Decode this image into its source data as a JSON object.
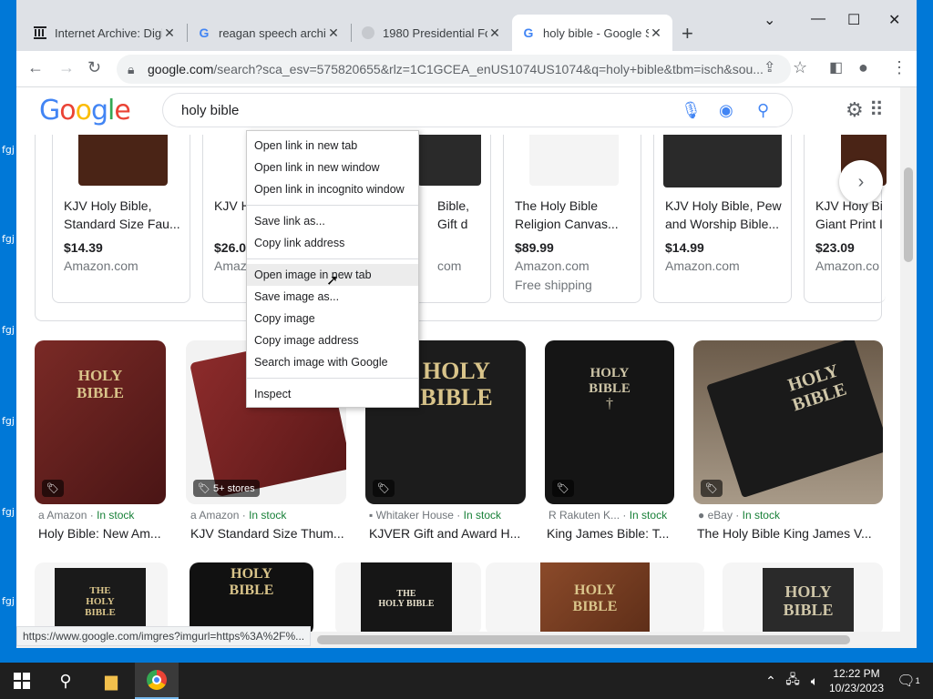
{
  "desktop": {
    "labels": [
      "fgj",
      "fgj",
      "fgj",
      "fgj",
      "fgj",
      "fgj"
    ]
  },
  "tabs": [
    {
      "title": "Internet Archive: Digi",
      "favicon": "archive-icon"
    },
    {
      "title": "reagan speech archiv",
      "favicon": "google-icon"
    },
    {
      "title": "1980 Presidential For",
      "favicon": "loading-icon"
    },
    {
      "title": "holy bible - Google S",
      "favicon": "google-icon",
      "active": true
    }
  ],
  "address": {
    "host": "google.com",
    "path": "/search?sca_esv=575820655&rlz=1C1GCEA_enUS1074US1074&q=holy+bible&tbm=isch&sou..."
  },
  "search": {
    "query": "holy bible"
  },
  "shopping": [
    {
      "title": "KJV Holy Bible, Standard Size Fau...",
      "price": "$14.39",
      "store": "Amazon.com",
      "shipping": ""
    },
    {
      "title": "KJV H Giant",
      "price": "$26.0",
      "store": "Amaz",
      "shipping": ""
    },
    {
      "title": "Bible, Gift d Bible -...",
      "price": "",
      "store": "com",
      "shipping": ""
    },
    {
      "title": "The Holy Bible Religion Canvas...",
      "price": "$89.99",
      "store": "Amazon.com",
      "shipping": "Free shipping"
    },
    {
      "title": "KJV Holy Bible, Pew and Worship Bible...",
      "price": "$14.99",
      "store": "Amazon.com",
      "shipping": ""
    },
    {
      "title": "KJV Holy Bi Giant Print I",
      "price": "$23.09",
      "store": "Amazon.co",
      "shipping": ""
    }
  ],
  "results": [
    {
      "store": "Amazon",
      "stock": "In stock",
      "title": "Holy Bible: New Am...",
      "cover": "HOLY\nBIBLE",
      "badge": ""
    },
    {
      "store": "Amazon",
      "stock": "In stock",
      "title": "KJV Standard Size Thum...",
      "cover": "",
      "badge": "5+ stores"
    },
    {
      "store": "Whitaker House",
      "stock": "In stock",
      "title": "KJVER Gift and Award H...",
      "cover": "HOLY\nBIBLE",
      "badge": ""
    },
    {
      "store": "Rakuten K...",
      "stock": "In stock",
      "title": "King James Bible: T...",
      "cover": "HOLY\nBIBLE",
      "badge": ""
    },
    {
      "store": "eBay",
      "stock": "In stock",
      "title": "The Holy Bible King James V...",
      "cover": "HOLY\nBIBLE",
      "badge": ""
    }
  ],
  "row3": [
    "THE HOLY BIBLE",
    "HOLY BIBLE",
    "THE HOLY BIBLE",
    "HOLY BIBLE",
    "HOLY BIBLE"
  ],
  "context_menu": [
    "Open link in new tab",
    "Open link in new window",
    "Open link in incognito window",
    "Save link as...",
    "Copy link address",
    "Open image in new tab",
    "Save image as...",
    "Copy image",
    "Copy image address",
    "Search image with Google",
    "Inspect"
  ],
  "status_url": "https://www.google.com/imgres?imgurl=https%3A%2F%...",
  "clock": {
    "time": "12:22 PM",
    "date": "10/23/2023"
  },
  "notif_count": "1"
}
